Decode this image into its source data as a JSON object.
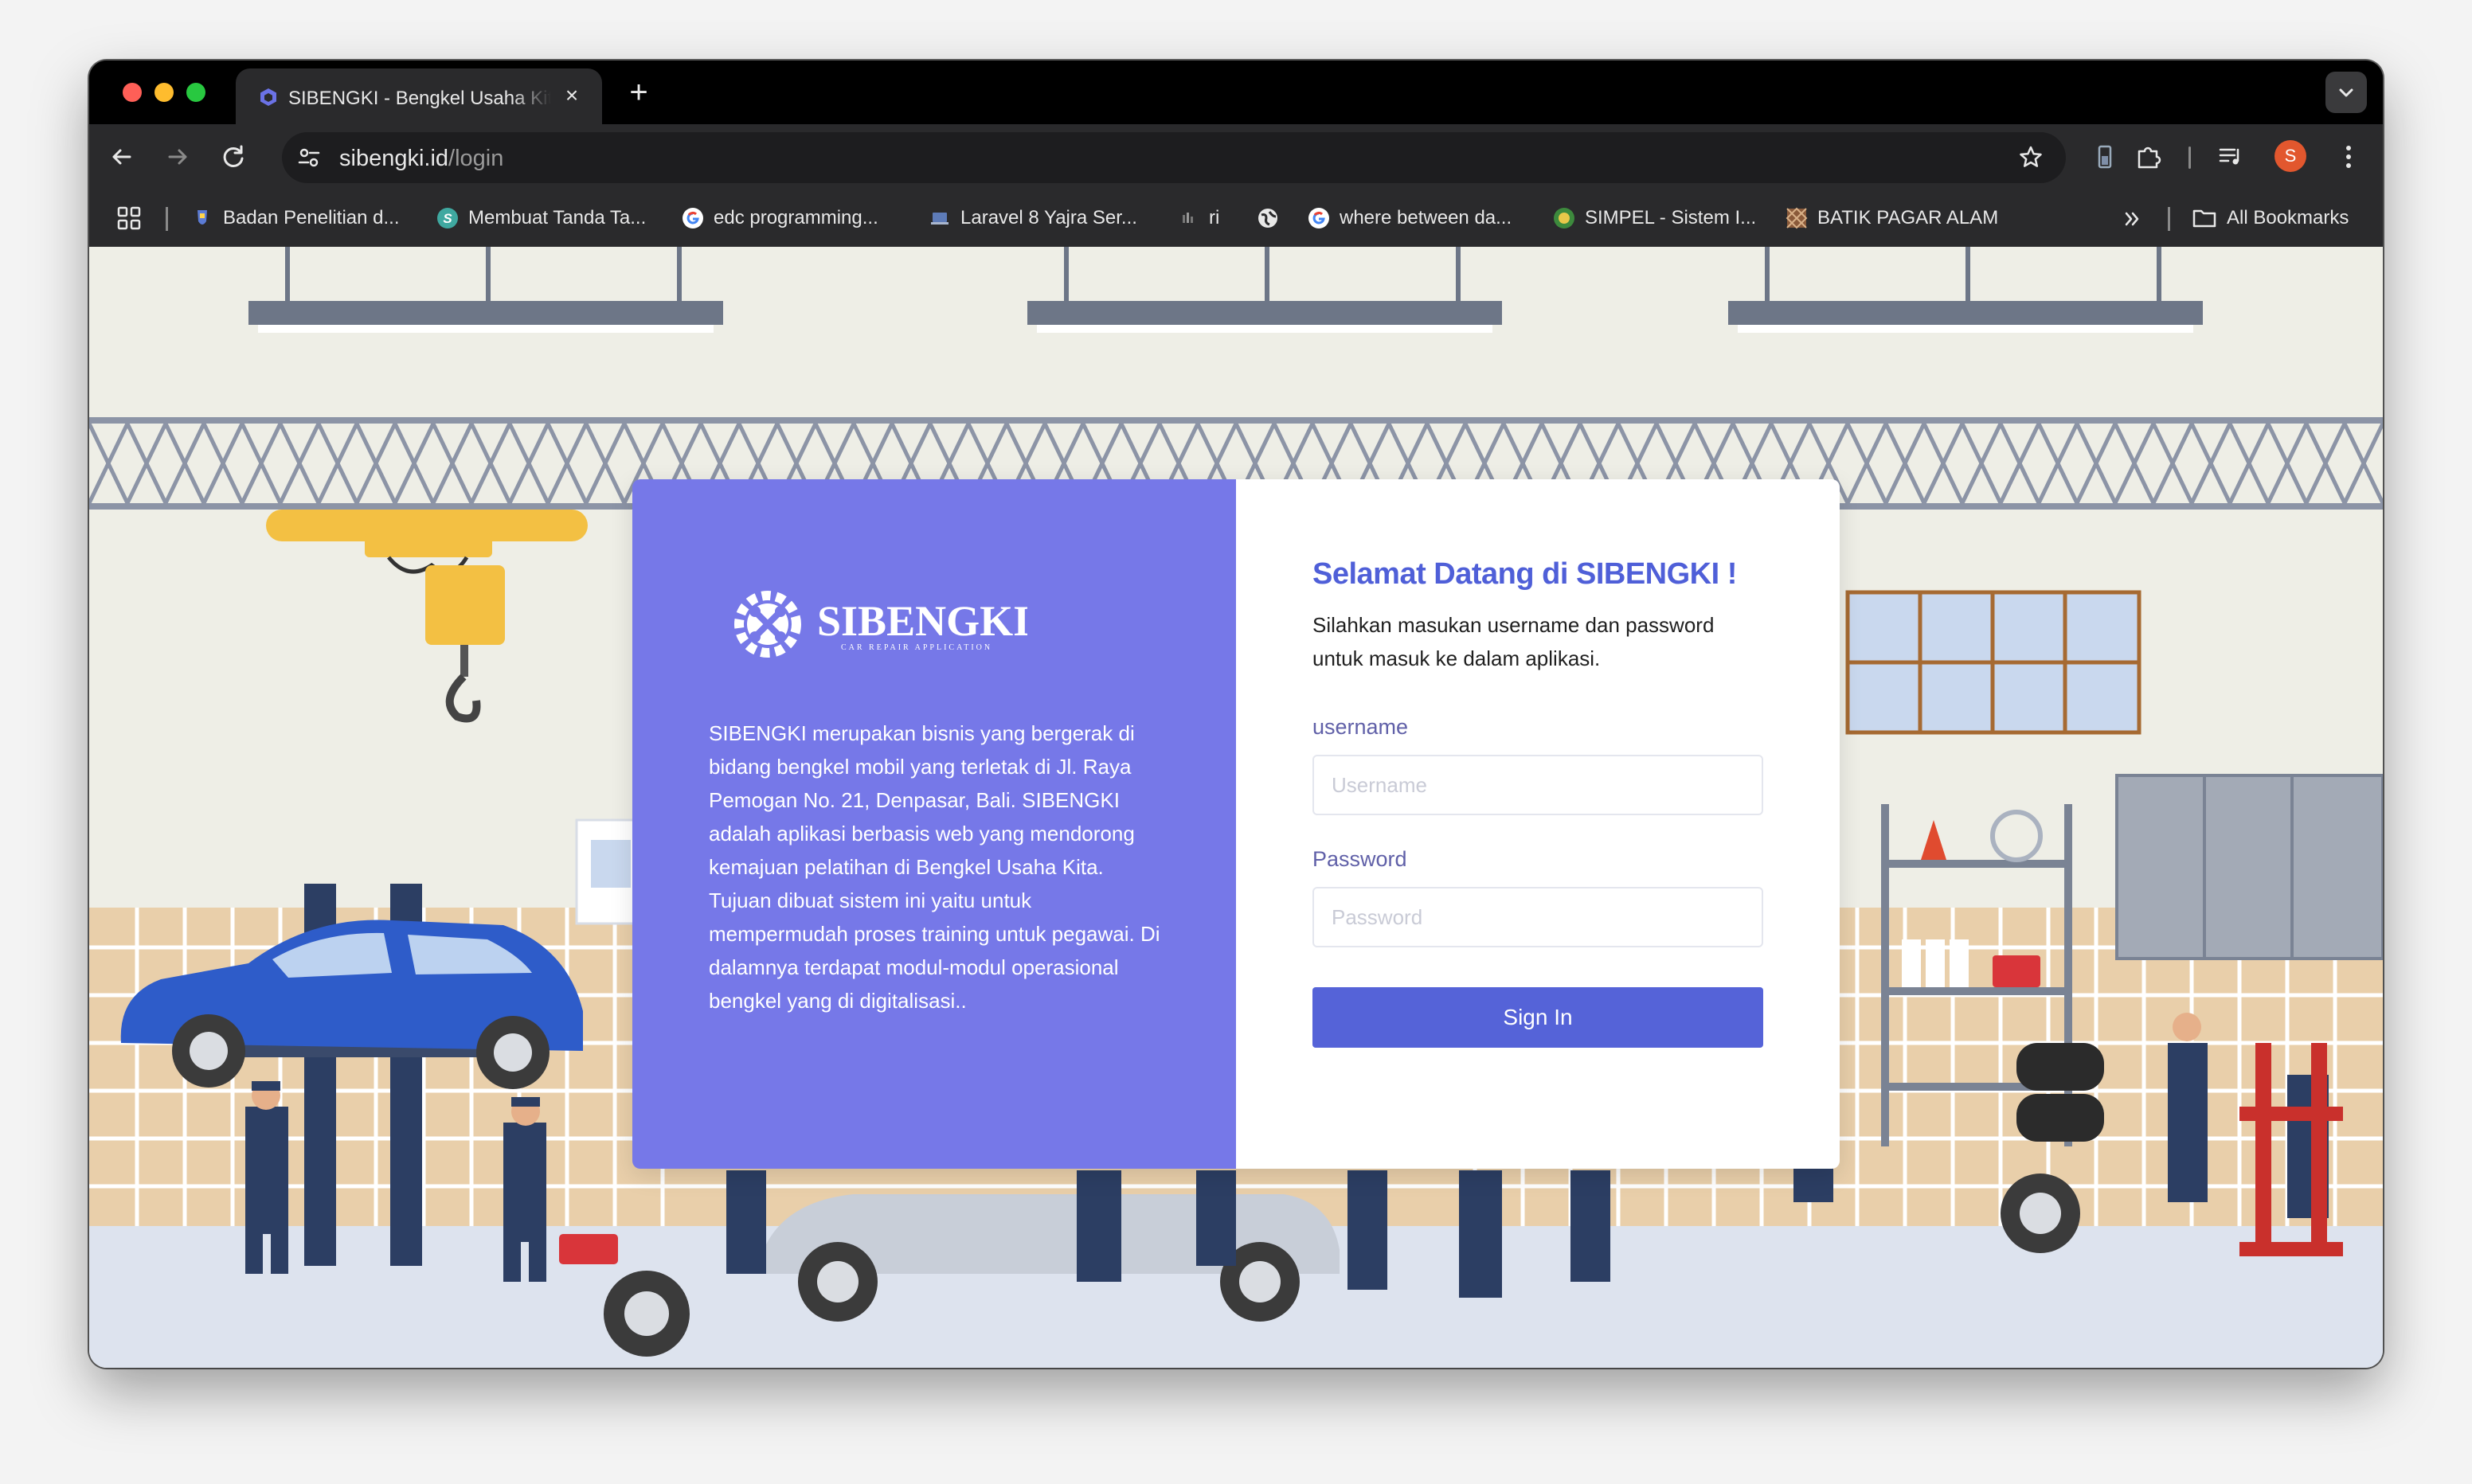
{
  "browser": {
    "tab": {
      "title": "SIBENGKI - Bengkel Usaha Kita"
    },
    "url": {
      "host": "sibengki.id",
      "path": "/login"
    },
    "profile_initial": "S",
    "bookmarks": [
      {
        "label": "Badan Penelitian d...",
        "icon": "agency-emblem-icon"
      },
      {
        "label": "Membuat Tanda Ta...",
        "icon": "s-logo-icon"
      },
      {
        "label": "edc programming...",
        "icon": "google-icon"
      },
      {
        "label": "Laravel 8 Yajra Ser...",
        "icon": "laptop-icon"
      },
      {
        "label": "ri",
        "icon": "bars-icon"
      },
      {
        "label": "",
        "icon": "globe-icon"
      },
      {
        "label": "where between da...",
        "icon": "google-icon"
      },
      {
        "label": "SIMPEL - Sistem I...",
        "icon": "emblem-icon"
      },
      {
        "label": "BATIK PAGAR ALAM",
        "icon": "pattern-icon"
      }
    ],
    "all_bookmarks_label": "All Bookmarks"
  },
  "brand": {
    "name": "SIBENGKI",
    "tagline": "CAR REPAIR APPLICATION"
  },
  "about_text": "SIBENGKI merupakan bisnis yang bergerak di bidang bengkel mobil yang terletak di Jl. Raya Pemogan No. 21, Denpasar, Bali. SIBENGKI adalah aplikasi berbasis web yang mendorong kemajuan pelatihan di Bengkel Usaha Kita. Tujuan dibuat sistem ini yaitu untuk mempermudah proses training untuk pegawai. Di dalamnya terdapat modul-modul operasional bengkel yang di digitalisasi..",
  "login": {
    "title": "Selamat Datang di SIBENGKI !",
    "subtitle": "Silahkan masukan username dan password untuk masuk ke dalam aplikasi.",
    "username_label": "username",
    "username_placeholder": "Username",
    "password_label": "Password",
    "password_placeholder": "Password",
    "submit_label": "Sign In"
  },
  "colors": {
    "brand_panel": "#7678e8",
    "primary_button": "#5563d8",
    "heading": "#4f5fd8"
  }
}
